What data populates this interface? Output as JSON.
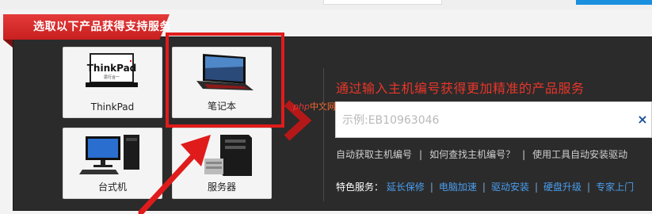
{
  "header": {
    "title": "选取以下产品获得支持服务"
  },
  "products": [
    {
      "label": "ThinkPad",
      "icon": "thinkpad-laptop-icon"
    },
    {
      "label": "笔记本",
      "icon": "notebook-laptop-icon"
    },
    {
      "label": "台式机",
      "icon": "desktop-pc-icon"
    },
    {
      "label": "服务器",
      "icon": "server-tower-icon"
    }
  ],
  "thinkpad_logo": {
    "brand": "ThinkPad",
    "tag": "思行合一"
  },
  "search": {
    "headline": "通过输入主机编号获得更加精准的产品服务",
    "placeholder": "示例:EB10963046",
    "clear_icon": "×"
  },
  "help_links": [
    "自动获取主机编号",
    "如何查找主机编号？",
    "使用工具自动安装驱动"
  ],
  "featured": {
    "label": "特色服务：",
    "items": [
      "延长保修",
      "电脑加速",
      "驱动安装",
      "硬盘升级",
      "专家上门"
    ]
  },
  "watermark": {
    "prefix": "php",
    "suffix": "中文网"
  },
  "colors": {
    "accent_red": "#e01b1b",
    "link_blue": "#4a9ef0",
    "panel": "#2b2b2b"
  }
}
